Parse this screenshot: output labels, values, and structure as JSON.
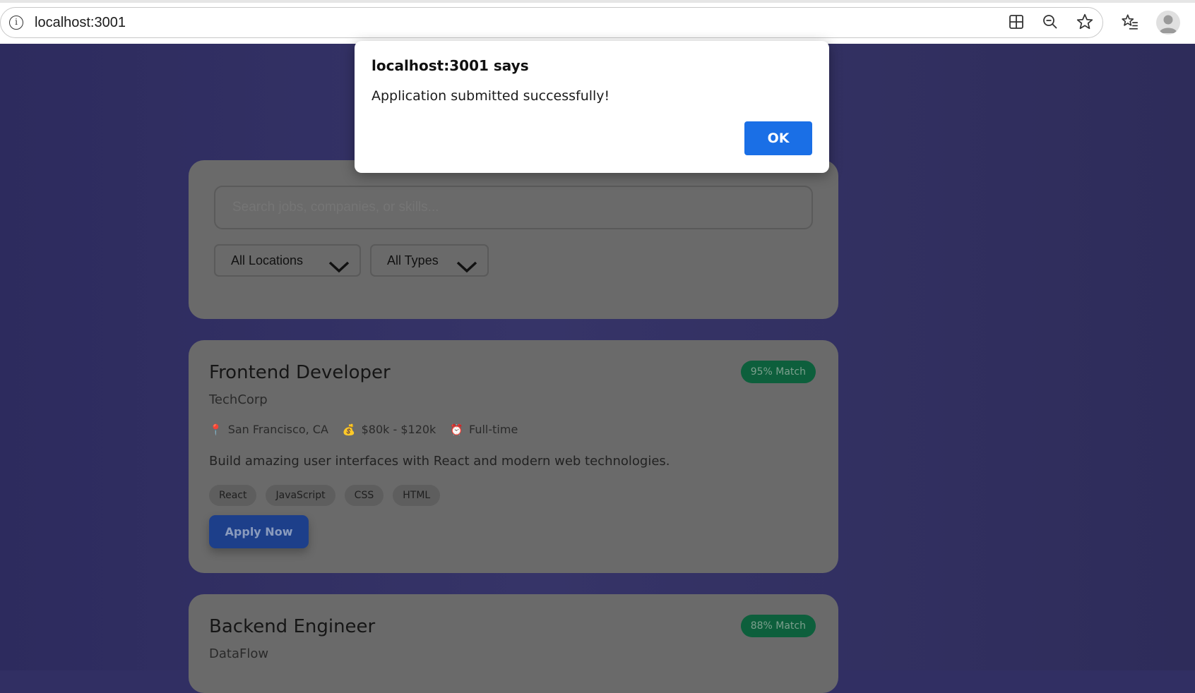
{
  "browser": {
    "url": "localhost:3001"
  },
  "alert": {
    "title": "localhost:3001 says",
    "message": "Application submitted successfully!",
    "ok_label": "OK"
  },
  "search": {
    "placeholder": "Search jobs, companies, or skills...",
    "location_filter": "All Locations",
    "type_filter": "All Types"
  },
  "jobs": [
    {
      "title": "Frontend Developer",
      "company": "TechCorp",
      "match": "95% Match",
      "location": "San Francisco, CA",
      "salary": "$80k - $120k",
      "type": "Full-time",
      "description": "Build amazing user interfaces with React and modern web technologies.",
      "tags": [
        "React",
        "JavaScript",
        "CSS",
        "HTML"
      ],
      "apply_label": "Apply Now"
    },
    {
      "title": "Backend Engineer",
      "company": "DataFlow",
      "match": "88% Match"
    }
  ],
  "icons": {
    "location": "📍",
    "salary": "💰",
    "type": "⏰"
  },
  "colors": {
    "background": "#312f63",
    "card": "#6a6a6a",
    "match_badge": "#0d5f3c",
    "apply_button": "#1d3f8a",
    "ok_button": "#1a6fe6"
  }
}
